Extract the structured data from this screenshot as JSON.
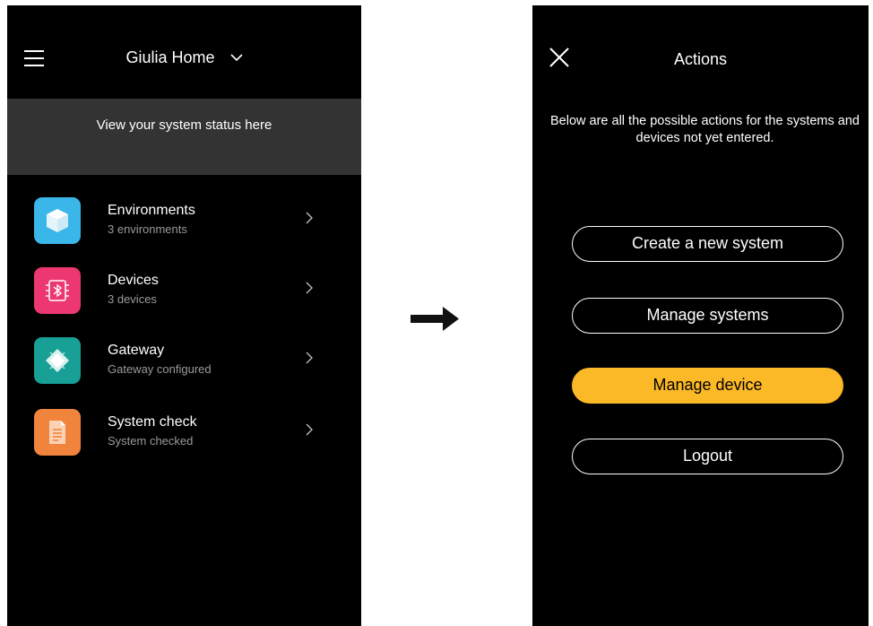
{
  "left_screen": {
    "header": {
      "title": "Giulia Home"
    },
    "status_banner": {
      "text": "View your system status here"
    },
    "items": [
      {
        "label": "Environments",
        "sub": "3 environments",
        "color": "#3bb6e8",
        "icon": "cube-icon"
      },
      {
        "label": "Devices",
        "sub": "3 devices",
        "color": "#ec3770",
        "icon": "bluetooth-chip-icon"
      },
      {
        "label": "Gateway",
        "sub": "Gateway configured",
        "color": "#18a096",
        "icon": "gateway-chip-icon"
      },
      {
        "label": "System check",
        "sub": "System checked",
        "color": "#f1843d",
        "icon": "document-icon"
      }
    ]
  },
  "flow_arrow": {
    "icon": "right-arrow-icon"
  },
  "right_screen": {
    "header": {
      "title": "Actions"
    },
    "description": "Below are all the possible actions for the systems and devices not yet entered.",
    "buttons": [
      {
        "label": "Create a new system"
      },
      {
        "label": "Manage systems"
      },
      {
        "label": "Manage device",
        "highlight_color": "#fbb827"
      },
      {
        "label": "Logout"
      }
    ]
  }
}
